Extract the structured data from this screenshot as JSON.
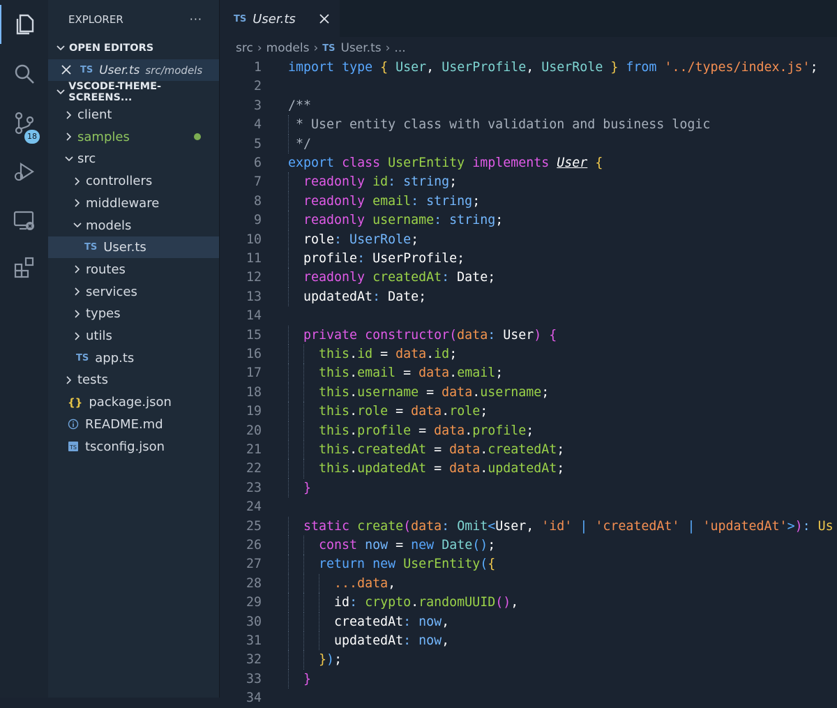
{
  "activity_bar": {
    "items": [
      {
        "name": "explorer-icon"
      },
      {
        "name": "search-icon"
      },
      {
        "name": "source-control-icon",
        "badge": "18"
      },
      {
        "name": "run-debug-icon"
      },
      {
        "name": "remote-explorer-icon"
      },
      {
        "name": "extensions-icon"
      }
    ]
  },
  "sidebar": {
    "title": "EXPLORER",
    "more": "···",
    "open_editors_label": "OPEN EDITORS",
    "open_editor": {
      "name": "User.ts",
      "path": "src/models"
    },
    "workspace_label": "VSCODE-THEME-SCREENS...",
    "tree": [
      {
        "label": "client",
        "type": "folder",
        "expanded": false
      },
      {
        "label": "samples",
        "type": "folder",
        "expanded": false,
        "modified": true
      },
      {
        "label": "src",
        "type": "folder",
        "expanded": true
      },
      {
        "label": "controllers",
        "type": "folder",
        "expanded": false
      },
      {
        "label": "middleware",
        "type": "folder",
        "expanded": false
      },
      {
        "label": "models",
        "type": "folder",
        "expanded": true
      },
      {
        "label": "User.ts",
        "type": "ts"
      },
      {
        "label": "routes",
        "type": "folder",
        "expanded": false
      },
      {
        "label": "services",
        "type": "folder",
        "expanded": false
      },
      {
        "label": "types",
        "type": "folder",
        "expanded": false
      },
      {
        "label": "utils",
        "type": "folder",
        "expanded": false
      },
      {
        "label": "app.ts",
        "type": "ts"
      },
      {
        "label": "tests",
        "type": "folder",
        "expanded": false
      },
      {
        "label": "package.json",
        "type": "json"
      },
      {
        "label": "README.md",
        "type": "info"
      },
      {
        "label": "tsconfig.json",
        "type": "tsconfig"
      }
    ]
  },
  "editor": {
    "tab": {
      "lang": "TS",
      "label": "User.ts"
    },
    "breadcrumbs": [
      "src",
      "models",
      "User.ts",
      "..."
    ],
    "lines": [
      {
        "n": "1",
        "tokens": [
          [
            "kw",
            "import"
          ],
          [
            "pl",
            " "
          ],
          [
            "kw",
            "type"
          ],
          [
            "pl",
            " "
          ],
          [
            "br",
            "{"
          ],
          [
            "pl",
            " "
          ],
          [
            "ty",
            "User"
          ],
          [
            "pl",
            ", "
          ],
          [
            "ty",
            "UserProfile"
          ],
          [
            "pl",
            ", "
          ],
          [
            "ty",
            "UserRole"
          ],
          [
            "pl",
            " "
          ],
          [
            "br",
            "}"
          ],
          [
            "pl",
            " "
          ],
          [
            "kw",
            "from"
          ],
          [
            "pl",
            " "
          ],
          [
            "st",
            "'../types/index.js'"
          ],
          [
            "pl",
            ";"
          ]
        ]
      },
      {
        "n": "2",
        "tokens": []
      },
      {
        "n": "3",
        "tokens": [
          [
            "cm",
            "/**"
          ]
        ]
      },
      {
        "n": "4",
        "tokens": [
          [
            "cm",
            " * User entity class with validation and business logic"
          ]
        ]
      },
      {
        "n": "5",
        "tokens": [
          [
            "cm",
            " */"
          ]
        ]
      },
      {
        "n": "6",
        "tokens": [
          [
            "kw",
            "export"
          ],
          [
            "pl",
            " "
          ],
          [
            "kw2",
            "class"
          ],
          [
            "pl",
            " "
          ],
          [
            "fn",
            "UserEntity"
          ],
          [
            "pl",
            " "
          ],
          [
            "kw2",
            "implements"
          ],
          [
            "pl",
            " "
          ],
          [
            "ul",
            "User"
          ],
          [
            "pl",
            " "
          ],
          [
            "br",
            "{"
          ]
        ]
      },
      {
        "n": "7",
        "tokens": [
          [
            "pl",
            "  "
          ],
          [
            "kw2",
            "readonly"
          ],
          [
            "pl",
            " "
          ],
          [
            "fn",
            "id"
          ],
          [
            "ty2",
            ": string"
          ],
          [
            "pl",
            ";"
          ]
        ]
      },
      {
        "n": "8",
        "tokens": [
          [
            "pl",
            "  "
          ],
          [
            "kw2",
            "readonly"
          ],
          [
            "pl",
            " "
          ],
          [
            "fn",
            "email"
          ],
          [
            "ty2",
            ": string"
          ],
          [
            "pl",
            ";"
          ]
        ]
      },
      {
        "n": "9",
        "tokens": [
          [
            "pl",
            "  "
          ],
          [
            "kw2",
            "readonly"
          ],
          [
            "pl",
            " "
          ],
          [
            "fn",
            "username"
          ],
          [
            "ty2",
            ": string"
          ],
          [
            "pl",
            ";"
          ]
        ]
      },
      {
        "n": "10",
        "tokens": [
          [
            "pl",
            "  role"
          ],
          [
            "ty2",
            ": UserRole"
          ],
          [
            "pl",
            ";"
          ]
        ]
      },
      {
        "n": "11",
        "tokens": [
          [
            "pl",
            "  profile"
          ],
          [
            "ty2",
            ": "
          ],
          [
            "pl",
            "UserProfile;"
          ]
        ]
      },
      {
        "n": "12",
        "tokens": [
          [
            "pl",
            "  "
          ],
          [
            "kw2",
            "readonly"
          ],
          [
            "pl",
            " "
          ],
          [
            "fn",
            "createdAt"
          ],
          [
            "ty2",
            ": "
          ],
          [
            "pl",
            "Date;"
          ]
        ]
      },
      {
        "n": "13",
        "tokens": [
          [
            "pl",
            "  updatedAt"
          ],
          [
            "ty2",
            ": "
          ],
          [
            "pl",
            "Date;"
          ]
        ]
      },
      {
        "n": "14",
        "tokens": []
      },
      {
        "n": "15",
        "tokens": [
          [
            "pl",
            "  "
          ],
          [
            "kw2",
            "private"
          ],
          [
            "pl",
            " "
          ],
          [
            "kw2",
            "constructor"
          ],
          [
            "br2",
            "("
          ],
          [
            "pr",
            "data"
          ],
          [
            "ty2",
            ": "
          ],
          [
            "pl",
            "User"
          ],
          [
            "br2",
            ")"
          ],
          [
            "pl",
            " "
          ],
          [
            "br2",
            "{"
          ]
        ]
      },
      {
        "n": "16",
        "tokens": [
          [
            "pl",
            "    "
          ],
          [
            "fn",
            "this"
          ],
          [
            "pl",
            "."
          ],
          [
            "fn",
            "id"
          ],
          [
            "pl",
            " = "
          ],
          [
            "pr",
            "data"
          ],
          [
            "pl",
            "."
          ],
          [
            "fn",
            "id"
          ],
          [
            "pl",
            ";"
          ]
        ]
      },
      {
        "n": "17",
        "tokens": [
          [
            "pl",
            "    "
          ],
          [
            "fn",
            "this"
          ],
          [
            "pl",
            "."
          ],
          [
            "fn",
            "email"
          ],
          [
            "pl",
            " = "
          ],
          [
            "pr",
            "data"
          ],
          [
            "pl",
            "."
          ],
          [
            "fn",
            "email"
          ],
          [
            "pl",
            ";"
          ]
        ]
      },
      {
        "n": "18",
        "tokens": [
          [
            "pl",
            "    "
          ],
          [
            "fn",
            "this"
          ],
          [
            "pl",
            "."
          ],
          [
            "fn",
            "username"
          ],
          [
            "pl",
            " = "
          ],
          [
            "pr",
            "data"
          ],
          [
            "pl",
            "."
          ],
          [
            "fn",
            "username"
          ],
          [
            "pl",
            ";"
          ]
        ]
      },
      {
        "n": "19",
        "tokens": [
          [
            "pl",
            "    "
          ],
          [
            "fn",
            "this"
          ],
          [
            "pl",
            "."
          ],
          [
            "fn",
            "role"
          ],
          [
            "pl",
            " = "
          ],
          [
            "pr",
            "data"
          ],
          [
            "pl",
            "."
          ],
          [
            "fn",
            "role"
          ],
          [
            "pl",
            ";"
          ]
        ]
      },
      {
        "n": "20",
        "tokens": [
          [
            "pl",
            "    "
          ],
          [
            "fn",
            "this"
          ],
          [
            "pl",
            "."
          ],
          [
            "fn",
            "profile"
          ],
          [
            "pl",
            " = "
          ],
          [
            "pr",
            "data"
          ],
          [
            "pl",
            "."
          ],
          [
            "fn",
            "profile"
          ],
          [
            "pl",
            ";"
          ]
        ]
      },
      {
        "n": "21",
        "tokens": [
          [
            "pl",
            "    "
          ],
          [
            "fn",
            "this"
          ],
          [
            "pl",
            "."
          ],
          [
            "fn",
            "createdAt"
          ],
          [
            "pl",
            " = "
          ],
          [
            "pr",
            "data"
          ],
          [
            "pl",
            "."
          ],
          [
            "fn",
            "createdAt"
          ],
          [
            "pl",
            ";"
          ]
        ]
      },
      {
        "n": "22",
        "tokens": [
          [
            "pl",
            "    "
          ],
          [
            "fn",
            "this"
          ],
          [
            "pl",
            "."
          ],
          [
            "fn",
            "updatedAt"
          ],
          [
            "pl",
            " = "
          ],
          [
            "pr",
            "data"
          ],
          [
            "pl",
            "."
          ],
          [
            "fn",
            "updatedAt"
          ],
          [
            "pl",
            ";"
          ]
        ]
      },
      {
        "n": "23",
        "tokens": [
          [
            "pl",
            "  "
          ],
          [
            "br2",
            "}"
          ]
        ]
      },
      {
        "n": "24",
        "tokens": []
      },
      {
        "n": "25",
        "tokens": [
          [
            "pl",
            "  "
          ],
          [
            "kw2",
            "static"
          ],
          [
            "pl",
            " "
          ],
          [
            "fn",
            "create"
          ],
          [
            "br2",
            "("
          ],
          [
            "pr",
            "data"
          ],
          [
            "ty2",
            ": "
          ],
          [
            "ty",
            "Omit"
          ],
          [
            "br3",
            "<"
          ],
          [
            "pl",
            "User, "
          ],
          [
            "st",
            "'id'"
          ],
          [
            "pl",
            " "
          ],
          [
            "br3",
            "|"
          ],
          [
            "pl",
            " "
          ],
          [
            "st",
            "'createdAt'"
          ],
          [
            "pl",
            " "
          ],
          [
            "br3",
            "|"
          ],
          [
            "pl",
            " "
          ],
          [
            "st",
            "'updatedAt'"
          ],
          [
            "br3",
            ">"
          ],
          [
            "br2",
            ")"
          ],
          [
            "ty2",
            ": "
          ],
          [
            "br",
            "Us"
          ]
        ]
      },
      {
        "n": "26",
        "tokens": [
          [
            "pl",
            "    "
          ],
          [
            "kw2",
            "const"
          ],
          [
            "pl",
            " "
          ],
          [
            "ty2",
            "now"
          ],
          [
            "pl",
            " = "
          ],
          [
            "kw",
            "new"
          ],
          [
            "pl",
            " "
          ],
          [
            "ty",
            "Date"
          ],
          [
            "br3",
            "()"
          ],
          [
            "pl",
            ";"
          ]
        ]
      },
      {
        "n": "27",
        "tokens": [
          [
            "pl",
            "    "
          ],
          [
            "kw",
            "return"
          ],
          [
            "pl",
            " "
          ],
          [
            "kw",
            "new"
          ],
          [
            "pl",
            " "
          ],
          [
            "fn",
            "UserEntity"
          ],
          [
            "br3",
            "("
          ],
          [
            "br",
            "{"
          ]
        ]
      },
      {
        "n": "28",
        "tokens": [
          [
            "pl",
            "      "
          ],
          [
            "pr",
            "...data"
          ],
          [
            "pl",
            ","
          ]
        ]
      },
      {
        "n": "29",
        "tokens": [
          [
            "pl",
            "      id"
          ],
          [
            "ty2",
            ": "
          ],
          [
            "fn",
            "crypto"
          ],
          [
            "pl",
            "."
          ],
          [
            "fn",
            "randomUUID"
          ],
          [
            "br2",
            "()"
          ],
          [
            "pl",
            ","
          ]
        ]
      },
      {
        "n": "30",
        "tokens": [
          [
            "pl",
            "      createdAt"
          ],
          [
            "ty2",
            ": now"
          ],
          [
            "pl",
            ","
          ]
        ]
      },
      {
        "n": "31",
        "tokens": [
          [
            "pl",
            "      updatedAt"
          ],
          [
            "ty2",
            ": now"
          ],
          [
            "pl",
            ","
          ]
        ]
      },
      {
        "n": "32",
        "tokens": [
          [
            "pl",
            "    "
          ],
          [
            "br",
            "}"
          ],
          [
            "br3",
            ")"
          ],
          [
            "pl",
            ";"
          ]
        ]
      },
      {
        "n": "33",
        "tokens": [
          [
            "pl",
            "  "
          ],
          [
            "br2",
            "}"
          ]
        ]
      },
      {
        "n": "34",
        "tokens": []
      }
    ]
  }
}
